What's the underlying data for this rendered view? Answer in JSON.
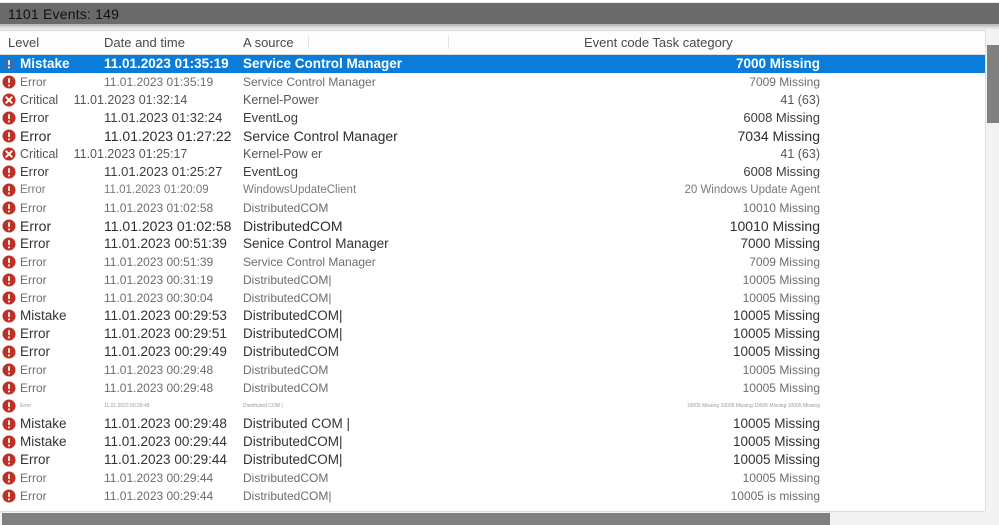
{
  "window": {
    "title": "1101 Events: 149"
  },
  "columns": {
    "level": "Level",
    "datetime": "Date and time",
    "source": "A source",
    "code": "Event code Task category"
  },
  "colors": {
    "selection": "#0a7ddb",
    "titlebar": "#6a6a6a",
    "error_icon": "#c0392b",
    "critical_icon": "#c0392b",
    "text": "#3d3d3d"
  },
  "rows": [
    {
      "icon": "error-icon",
      "level": "Mistake",
      "datetime": "11.01.2023 01:35:19",
      "source": "Service Control Manager",
      "code": "7000 Missing",
      "selected": true,
      "style": "t-c",
      "inline_date": false
    },
    {
      "icon": "error-icon",
      "level": "Error",
      "datetime": "11.01.2023 01:35:19",
      "source": "Service Control Manager",
      "code": "7009 Missing",
      "selected": false,
      "style": "t-b",
      "inline_date": false
    },
    {
      "icon": "critical-icon",
      "level": "Critical",
      "datetime": "11.01.2023 01:32:14",
      "source": "Kernel-Power",
      "code": "41   (63)",
      "selected": false,
      "style": "t-d",
      "inline_date": true
    },
    {
      "icon": "error-icon",
      "level": "Error",
      "datetime": "11.01.2023 01:32:24",
      "source": "EventLog",
      "code": "6008 Missing",
      "selected": false,
      "style": "t-a",
      "inline_date": false
    },
    {
      "icon": "error-icon",
      "level": "Error",
      "datetime": "11.01.2023 01:27:22",
      "source": "Service Control Manager",
      "code": "7034 Missing",
      "selected": false,
      "style": "t-e",
      "inline_date": false
    },
    {
      "icon": "critical-icon",
      "level": "Critical",
      "datetime": "11.01.2023 01:25:17",
      "source": "Kernel-Pow er",
      "code": "41   (63)",
      "selected": false,
      "style": "t-d",
      "inline_date": true
    },
    {
      "icon": "error-icon",
      "level": "Error",
      "datetime": "11.01.2023 01:25:27",
      "source": "EventLog",
      "code": "6008 Missing",
      "selected": false,
      "style": "t-a",
      "inline_date": false
    },
    {
      "icon": "error-icon",
      "level": "Error",
      "datetime": "11.01.2023 01:20:09",
      "source": "WindowsUpdateClient",
      "code": "20 Windows Update Agent",
      "selected": false,
      "style": "t-f",
      "inline_date": false
    },
    {
      "icon": "error-icon",
      "level": "Error",
      "datetime": "11.01.2023 01:02:58",
      "source": "DistributedCOM",
      "code": "10010 Missing",
      "selected": false,
      "style": "t-b",
      "inline_date": false
    },
    {
      "icon": "error-icon",
      "level": "Error",
      "datetime": "11.01.2023 01:02:58",
      "source": "DistributedCOM",
      "code": "10010 Missing",
      "selected": false,
      "style": "t-e",
      "inline_date": false
    },
    {
      "icon": "error-icon",
      "level": "Error",
      "datetime": "11.01.2023 00:51:39",
      "source": "Senice Control Manager",
      "code": "7000 Missing",
      "selected": false,
      "style": "t-c",
      "inline_date": false
    },
    {
      "icon": "error-icon",
      "level": "Error",
      "datetime": "11.01.2023 00:51:39",
      "source": "Service Control Manager",
      "code": "7009 Missing",
      "selected": false,
      "style": "t-b",
      "inline_date": false
    },
    {
      "icon": "error-icon",
      "level": "Error",
      "datetime": "11.01.2023 00:31:19",
      "source": "DistributedCOM|",
      "code": "10005 Missing",
      "selected": false,
      "style": "t-b",
      "inline_date": false
    },
    {
      "icon": "error-icon",
      "level": "Error",
      "datetime": "11.01.2023 00:30:04",
      "source": "DistributedCOM|",
      "code": "10005 Missing",
      "selected": false,
      "style": "t-b",
      "inline_date": false
    },
    {
      "icon": "error-icon",
      "level": "Mistake",
      "datetime": "11.01.2023 00:29:53",
      "source": "DistributedCOM|",
      "code": "10005 Missing",
      "selected": false,
      "style": "t-c",
      "inline_date": false
    },
    {
      "icon": "error-icon",
      "level": "Error",
      "datetime": "11.01.2023 00:29:51",
      "source": "DistributedCOM|",
      "code": "10005 Missing",
      "selected": false,
      "style": "t-c",
      "inline_date": false
    },
    {
      "icon": "error-icon",
      "level": "Error",
      "datetime": "11.01.2023 00:29:49",
      "source": "DistributedCOM",
      "code": "10005 Missing",
      "selected": false,
      "style": "t-c",
      "inline_date": false
    },
    {
      "icon": "error-icon",
      "level": "Error",
      "datetime": "11.01.2023 00:29:48",
      "source": "DistributedCOM",
      "code": "10005 Missing",
      "selected": false,
      "style": "t-b",
      "inline_date": false
    },
    {
      "icon": "error-icon",
      "level": "Error",
      "datetime": "11.01.2023 00:29:48",
      "source": "DistributedCOM",
      "code": "10005 Missing",
      "selected": false,
      "style": "t-b",
      "inline_date": false
    },
    {
      "icon": "error-icon",
      "level": "Error",
      "datetime": "11.01.2023 00:29:48",
      "source": "Distributed COM |",
      "code": "10005 Missing 10005 Missing 10005 Missing 10005 Missing",
      "selected": false,
      "style": "t-tiny",
      "inline_date": false
    },
    {
      "icon": "error-icon",
      "level": "Mistake",
      "datetime": "11.01.2023 00:29:48",
      "source": "Distributed COM |",
      "code": "10005 Missing",
      "selected": false,
      "style": "t-c",
      "inline_date": false
    },
    {
      "icon": "error-icon",
      "level": "Mistake",
      "datetime": "11.01.2023 00:29:44",
      "source": "DistributedCOM|",
      "code": "10005 Missing",
      "selected": false,
      "style": "t-c",
      "inline_date": false
    },
    {
      "icon": "error-icon",
      "level": "Error",
      "datetime": "11.01.2023 00:29:44",
      "source": "DistributedCOM|",
      "code": "10005 Missing",
      "selected": false,
      "style": "t-c",
      "inline_date": false
    },
    {
      "icon": "error-icon",
      "level": "Error",
      "datetime": "11.01.2023 00:29:44",
      "source": "DistributedCOM",
      "code": "10005 Missing",
      "selected": false,
      "style": "t-b",
      "inline_date": false
    },
    {
      "icon": "error-icon",
      "level": "Error",
      "datetime": "11.01.2023 00:29:44",
      "source": "DistributedCOM|",
      "code": "10005 is missing",
      "selected": false,
      "style": "t-b",
      "inline_date": false
    }
  ]
}
